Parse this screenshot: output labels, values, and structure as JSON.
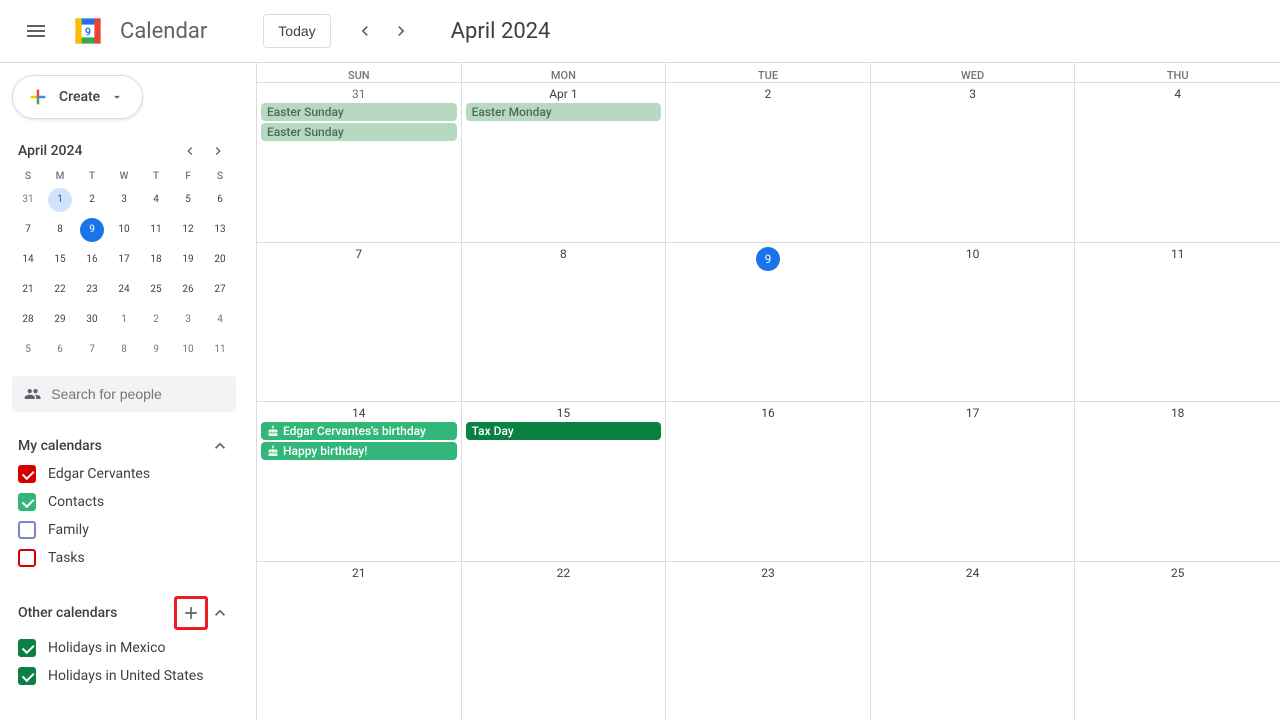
{
  "header": {
    "app_name": "Calendar",
    "today_label": "Today",
    "period_title": "April 2024"
  },
  "create": {
    "label": "Create"
  },
  "mini": {
    "title": "April 2024",
    "dow": [
      "S",
      "M",
      "T",
      "W",
      "T",
      "F",
      "S"
    ],
    "rows": [
      [
        {
          "n": "31",
          "o": true
        },
        {
          "n": "1",
          "first": true
        },
        {
          "n": "2"
        },
        {
          "n": "3"
        },
        {
          "n": "4"
        },
        {
          "n": "5"
        },
        {
          "n": "6"
        }
      ],
      [
        {
          "n": "7"
        },
        {
          "n": "8"
        },
        {
          "n": "9",
          "today": true
        },
        {
          "n": "10"
        },
        {
          "n": "11"
        },
        {
          "n": "12"
        },
        {
          "n": "13"
        }
      ],
      [
        {
          "n": "14"
        },
        {
          "n": "15"
        },
        {
          "n": "16"
        },
        {
          "n": "17"
        },
        {
          "n": "18"
        },
        {
          "n": "19"
        },
        {
          "n": "20"
        }
      ],
      [
        {
          "n": "21"
        },
        {
          "n": "22"
        },
        {
          "n": "23"
        },
        {
          "n": "24"
        },
        {
          "n": "25"
        },
        {
          "n": "26"
        },
        {
          "n": "27"
        }
      ],
      [
        {
          "n": "28"
        },
        {
          "n": "29"
        },
        {
          "n": "30"
        },
        {
          "n": "1",
          "o": true
        },
        {
          "n": "2",
          "o": true
        },
        {
          "n": "3",
          "o": true
        },
        {
          "n": "4",
          "o": true
        }
      ],
      [
        {
          "n": "5",
          "o": true
        },
        {
          "n": "6",
          "o": true
        },
        {
          "n": "7",
          "o": true
        },
        {
          "n": "8",
          "o": true
        },
        {
          "n": "9",
          "o": true
        },
        {
          "n": "10",
          "o": true
        },
        {
          "n": "11",
          "o": true
        }
      ]
    ]
  },
  "search": {
    "placeholder": "Search for people"
  },
  "my_calendars": {
    "title": "My calendars",
    "items": [
      {
        "label": "Edgar Cervantes",
        "color": "#d50000",
        "checked": true
      },
      {
        "label": "Contacts",
        "color": "#33b679",
        "checked": true
      },
      {
        "label": "Family",
        "color": "#7986cb",
        "checked": false
      },
      {
        "label": "Tasks",
        "color": "#d50000",
        "checked": false
      }
    ]
  },
  "other_calendars": {
    "title": "Other calendars",
    "items": [
      {
        "label": "Holidays in Mexico",
        "color": "#0b8043",
        "checked": true
      },
      {
        "label": "Holidays in United States",
        "color": "#0b8043",
        "checked": true
      }
    ]
  },
  "grid": {
    "dow": [
      "SUN",
      "MON",
      "TUE",
      "WED",
      "THU"
    ],
    "weeks": [
      [
        {
          "date": "31",
          "other": true,
          "events": [
            {
              "t": "Easter Sunday",
              "cls": "ev-faded"
            },
            {
              "t": "Easter Sunday",
              "cls": "ev-faded"
            }
          ]
        },
        {
          "date": "Apr 1",
          "events": [
            {
              "t": "Easter Monday",
              "cls": "ev-faded"
            }
          ]
        },
        {
          "date": "2"
        },
        {
          "date": "3"
        },
        {
          "date": "4"
        }
      ],
      [
        {
          "date": "7"
        },
        {
          "date": "8"
        },
        {
          "date": "9",
          "today": true
        },
        {
          "date": "10"
        },
        {
          "date": "11"
        }
      ],
      [
        {
          "date": "14",
          "events": [
            {
              "t": "Edgar Cervantes's birthday",
              "cls": "ev-lgreen",
              "icon": true
            },
            {
              "t": "Happy birthday!",
              "cls": "ev-lgreen",
              "icon": true
            }
          ]
        },
        {
          "date": "15",
          "events": [
            {
              "t": "Tax Day",
              "cls": "ev-green"
            }
          ]
        },
        {
          "date": "16"
        },
        {
          "date": "17"
        },
        {
          "date": "18"
        }
      ],
      [
        {
          "date": "21"
        },
        {
          "date": "22"
        },
        {
          "date": "23"
        },
        {
          "date": "24"
        },
        {
          "date": "25"
        }
      ]
    ]
  }
}
